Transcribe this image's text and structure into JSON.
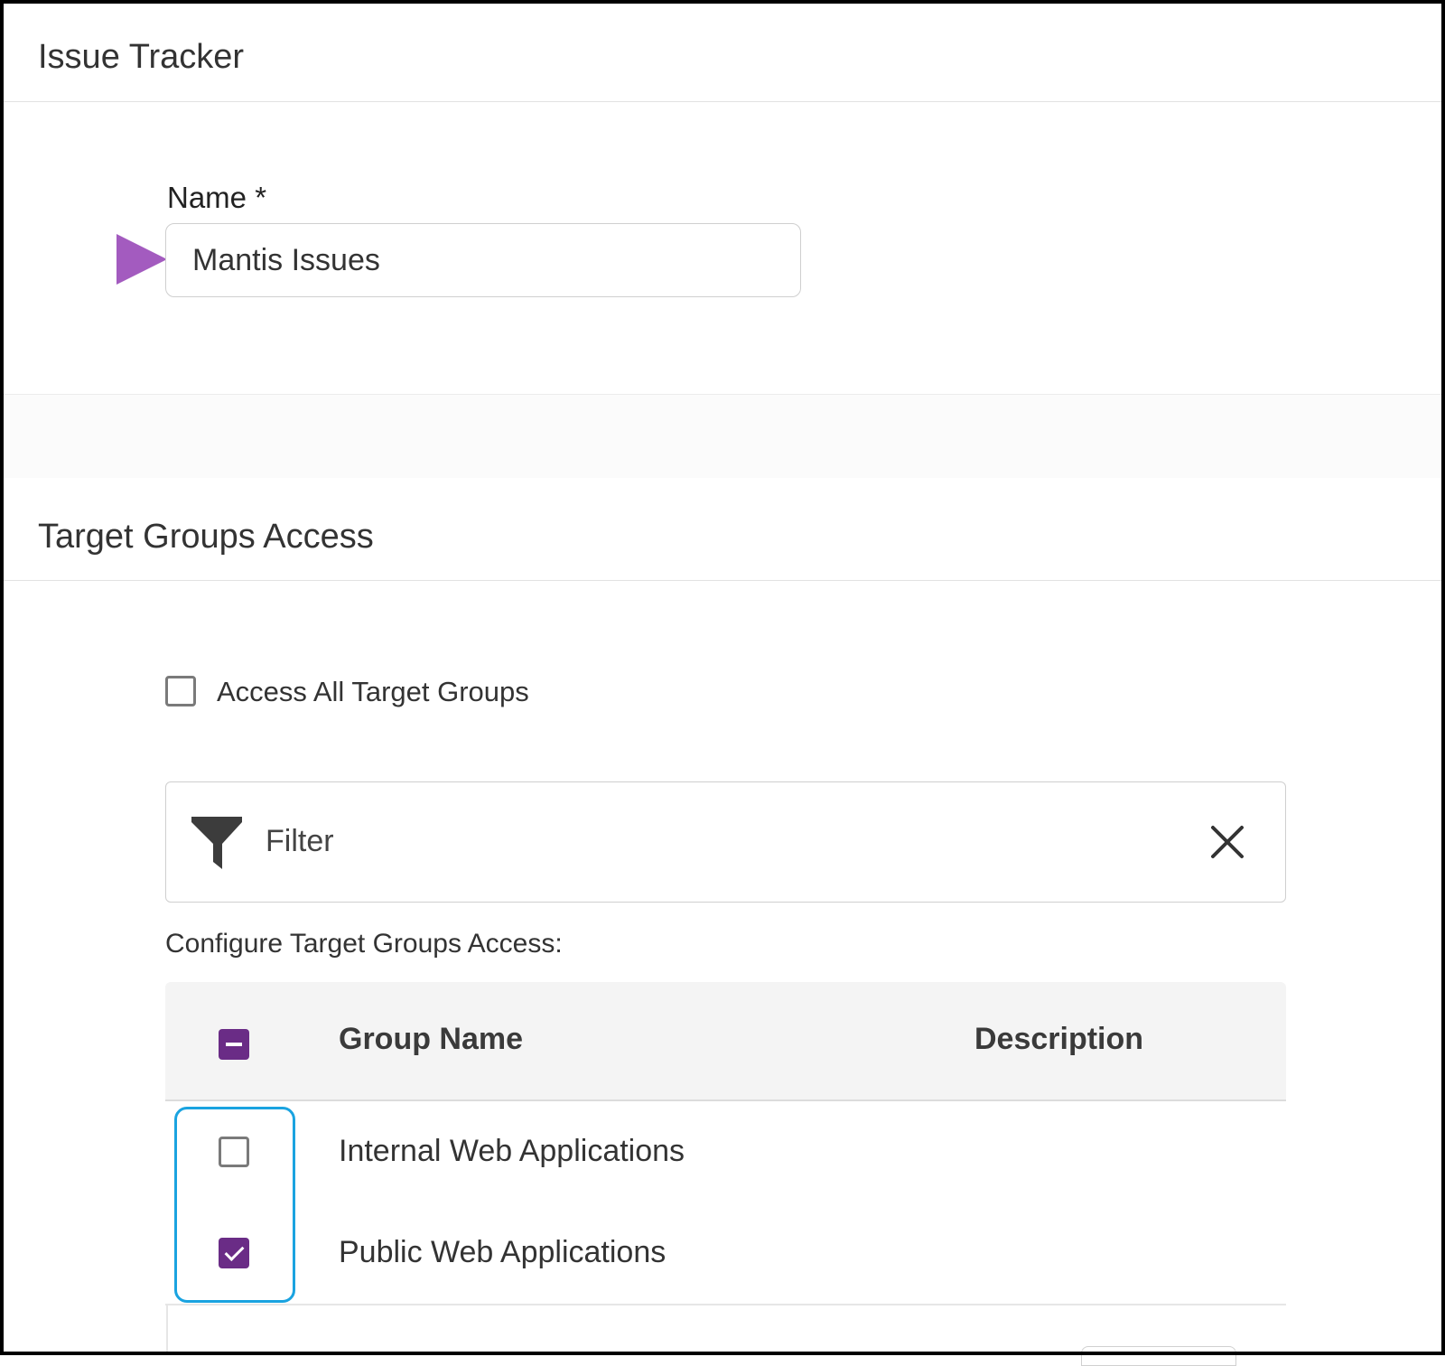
{
  "issue_tracker": {
    "title": "Issue Tracker",
    "name_label": "Name *",
    "name_value": "Mantis Issues"
  },
  "target_groups": {
    "title": "Target Groups Access",
    "access_all_label": "Access All Target Groups",
    "access_all_checked": false,
    "filter_placeholder": "Filter",
    "configure_label": "Configure Target Groups Access:",
    "table": {
      "columns": [
        "Group Name",
        "Description"
      ],
      "select_all_state": "indeterminate",
      "rows": [
        {
          "group_name": "Internal Web Applications",
          "description": "",
          "checked": false
        },
        {
          "group_name": "Public Web Applications",
          "description": "",
          "checked": true
        }
      ]
    }
  },
  "icons": {
    "arrow": "arrow-pointer-icon",
    "filter": "funnel-icon",
    "clear": "close-icon"
  },
  "colors": {
    "accent_purple": "#6a2c86",
    "arrow_purple": "#a35bbf",
    "highlight_blue": "#1aa3e0"
  }
}
